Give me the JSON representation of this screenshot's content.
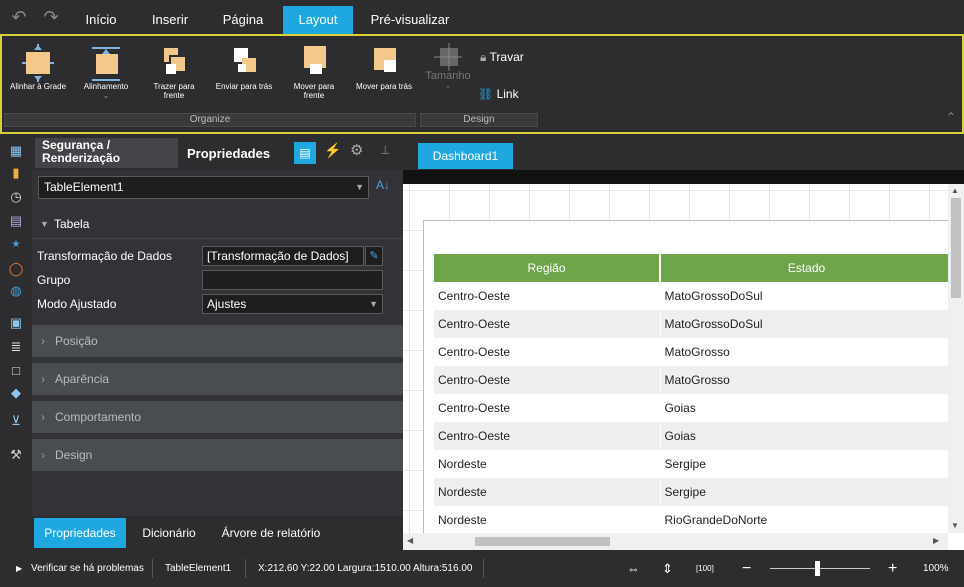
{
  "menu": {
    "undo_icon": "undo-icon",
    "redo_icon": "redo-icon",
    "tabs": [
      "Início",
      "Inserir",
      "Página",
      "Layout",
      "Pré-visualizar"
    ],
    "active_tab": "Layout"
  },
  "ribbon": {
    "buttons": {
      "align_grid": "Alinhar à Grade",
      "alignment": "Alinhamento",
      "bring_front": "Trazer para frente",
      "send_back": "Enviar para trás",
      "move_front": "Mover para frente",
      "move_back": "Mover para trás",
      "size": "Tamanho",
      "lock": "Travar",
      "link": "Link"
    },
    "groups": {
      "organize": "Organize",
      "design": "Design"
    }
  },
  "panel": {
    "tabs": {
      "security": "Segurança / Renderização",
      "properties": "Propriedades"
    },
    "element_combo": "TableElement1",
    "section_tabela": "Tabela",
    "props": {
      "transform_label": "Transformação de Dados",
      "transform_value": "[Transformação de Dados]",
      "group_label": "Grupo",
      "group_value": "",
      "mode_label": "Modo Ajustado",
      "mode_value": "Ajustes"
    },
    "sections": [
      "Posição",
      "Aparência",
      "Comportamento",
      "Design"
    ],
    "bottom_tabs": [
      "Propriedades",
      "Dicionário",
      "Árvore de relatório"
    ],
    "active_bottom": "Propriedades"
  },
  "canvas": {
    "page_tab": "Dashboard1",
    "table": {
      "headers": [
        "Região",
        "Estado"
      ],
      "rows": [
        [
          "Centro-Oeste",
          "MatoGrossoDoSul"
        ],
        [
          "Centro-Oeste",
          "MatoGrossoDoSul"
        ],
        [
          "Centro-Oeste",
          "MatoGrosso"
        ],
        [
          "Centro-Oeste",
          "MatoGrosso"
        ],
        [
          "Centro-Oeste",
          "Goias"
        ],
        [
          "Centro-Oeste",
          "Goias"
        ],
        [
          "Nordeste",
          "Sergipe"
        ],
        [
          "Nordeste",
          "Sergipe"
        ],
        [
          "Nordeste",
          "RioGrandeDoNorte"
        ]
      ],
      "header_color": "#6ea54b"
    }
  },
  "status": {
    "check": "Verificar se há problemas",
    "element": "TableElement1",
    "coords": "X:212.60 Y:22.00 Largura:1510.00 Altura:516.00",
    "zoom": "100%"
  },
  "colors": {
    "accent": "#1fa8e0",
    "ribbon_border": "#d8d23a"
  }
}
